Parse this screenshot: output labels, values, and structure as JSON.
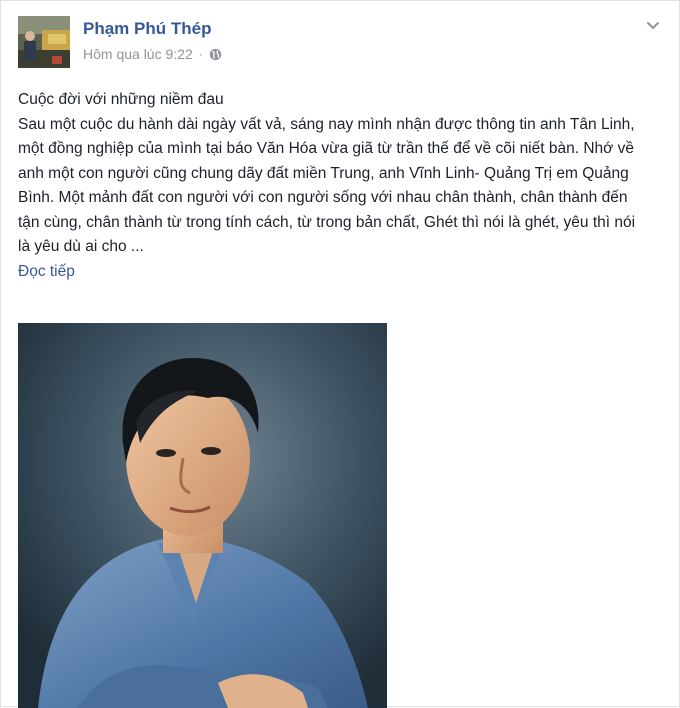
{
  "post": {
    "author": "Phạm Phú Thép",
    "timestamp": "Hôm qua lúc 9:22",
    "separator": "·",
    "privacy_icon": "globe-icon",
    "options_icon": "chevron-down-icon",
    "title_line": "Cuộc đời với những niềm đau",
    "body": "Sau một cuộc du hành dài ngày vất vả, sáng nay mình nhận được thông tin anh Tân Linh, một đồng nghiệp của mình tại báo Văn Hóa vừa giã từ trần thế để về cõi niết bàn. Nhớ về anh một con người cũng chung dãy đất miền Trung, anh Vĩnh Linh- Quảng Trị em Quảng Bình. Một mảnh đất con người với con người sống với nhau chân thành, chân thành đến tận cùng, chân thành từ trong tính cách, từ trong bản chất, Ghét thì nói là ghét, yêu thì nói là yêu dù ai cho ...",
    "see_more": "Đọc tiếp"
  },
  "colors": {
    "link": "#365899",
    "text": "#1d2129",
    "meta": "#90949c"
  }
}
